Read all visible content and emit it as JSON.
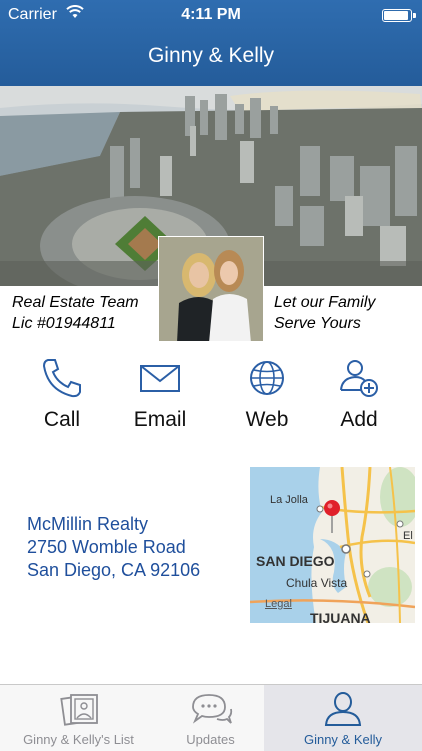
{
  "status_bar": {
    "carrier": "Carrier",
    "time": "4:11 PM",
    "battery_level": 0.95
  },
  "nav": {
    "title": "Ginny & Kelly"
  },
  "hero": {
    "icon": "aerial-city-photo"
  },
  "profile": {
    "tagline_left": [
      "Real Estate Team",
      "Lic #01944811"
    ],
    "tagline_right": [
      "Let our Family",
      "Serve Yours"
    ],
    "photo_icon": "agents-portrait"
  },
  "actions": [
    {
      "label": "Call",
      "icon": "phone-icon"
    },
    {
      "label": "Email",
      "icon": "envelope-icon"
    },
    {
      "label": "Web",
      "icon": "globe-icon"
    },
    {
      "label": "Add",
      "icon": "add-contact-icon"
    }
  ],
  "address": {
    "line1": "McMillin Realty",
    "line2": "2750 Womble Road",
    "line3": "San Diego, CA 92106"
  },
  "map": {
    "labels": [
      "La Jolla",
      "SAN DIEGO",
      "Chula Vista",
      "TIJUANA",
      "El"
    ],
    "legal": "Legal",
    "pin_color": "#e0202a"
  },
  "tabs": [
    {
      "label": "Ginny & Kelly's List",
      "icon": "photo-album-icon",
      "active": false
    },
    {
      "label": "Updates",
      "icon": "chat-bubble-icon",
      "active": false
    },
    {
      "label": "Ginny & Kelly",
      "icon": "person-icon",
      "active": true
    }
  ],
  "colors": {
    "brand_blue": "#245c9a",
    "link_blue": "#1f4f9c",
    "icon_blue": "#2b5fa6"
  }
}
